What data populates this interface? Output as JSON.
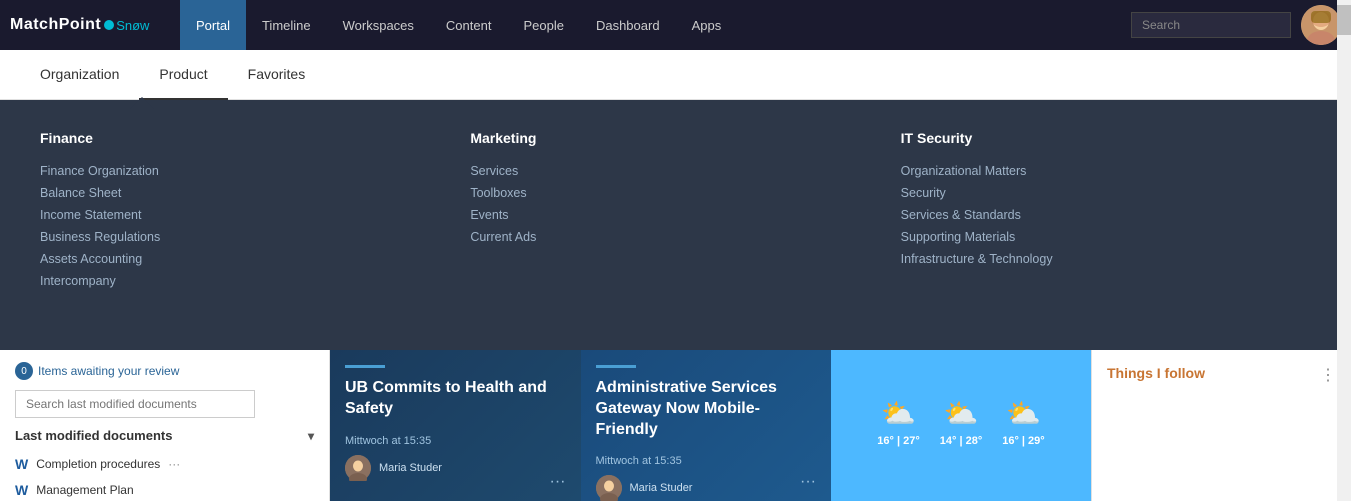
{
  "topNav": {
    "logo": "MatchPoint",
    "logoSnow": "Snøw",
    "items": [
      {
        "label": "Portal",
        "active": true
      },
      {
        "label": "Timeline",
        "active": false
      },
      {
        "label": "Workspaces",
        "active": false
      },
      {
        "label": "Content",
        "active": false
      },
      {
        "label": "People",
        "active": false
      },
      {
        "label": "Dashboard",
        "active": false
      },
      {
        "label": "Apps",
        "active": false
      }
    ],
    "searchPlaceholder": "Search"
  },
  "secondNav": {
    "items": [
      {
        "label": "Organization"
      },
      {
        "label": "Product",
        "active": true
      },
      {
        "label": "Favorites"
      }
    ]
  },
  "dropdown": {
    "sections": [
      {
        "title": "Finance",
        "items": [
          "Finance Organization",
          "Balance Sheet",
          "Income Statement",
          "Business Regulations",
          "Assets Accounting",
          "Intercompany"
        ]
      },
      {
        "title": "Marketing",
        "items": [
          "Services",
          "Toolboxes",
          "Events",
          "Current Ads"
        ]
      },
      {
        "title": "IT Security",
        "items": [
          "Organizational Matters",
          "Security",
          "Services & Standards",
          "Supporting Materials",
          "Infrastructure & Technology"
        ]
      }
    ]
  },
  "leftPanel": {
    "reviewCount": "0",
    "reviewLabel": "Items awaiting your review",
    "searchPlaceholder": "Search last modified documents",
    "lastModifiedLabel": "Last modified documents",
    "docs": [
      {
        "name": "Completion procedures",
        "icon": "W"
      },
      {
        "name": "Management Plan",
        "icon": "W"
      }
    ]
  },
  "cards": [
    {
      "title": "UB Commits to Health and Safety",
      "date": "Mittwoch at 15:35",
      "author": "Maria Studer",
      "type": "dark"
    },
    {
      "title": "Administrative Services Gateway Now Mobile-Friendly",
      "date": "Mittwoch at 15:35",
      "author": "Maria Studer",
      "type": "blue"
    }
  ],
  "weather": {
    "days": [
      {
        "icon": "⛅",
        "temp": "16° | 27°"
      },
      {
        "icon": "⛅",
        "temp": "14° | 28°"
      },
      {
        "icon": "⛅",
        "temp": "16° | 29°"
      }
    ]
  },
  "follow": {
    "title": "Things I follow"
  }
}
